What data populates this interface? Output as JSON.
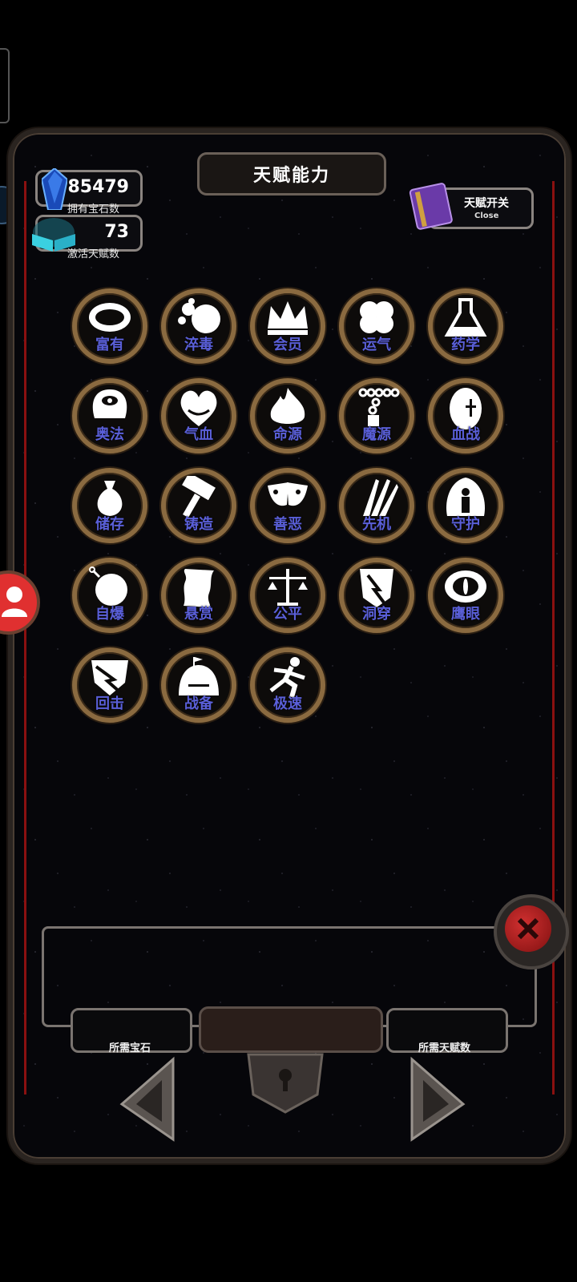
{
  "header": {
    "title": "天赋能力"
  },
  "stats": {
    "gems": {
      "value": "85479",
      "label": "拥有宝石数"
    },
    "talents": {
      "value": "73",
      "label": "激活天赋数"
    }
  },
  "toggle": {
    "label": "天赋开关",
    "sub": "Close"
  },
  "talents": [
    {
      "label": "富有",
      "icon": "ring-icon"
    },
    {
      "label": "淬毒",
      "icon": "poison-bubbles-icon"
    },
    {
      "label": "会员",
      "icon": "crown-icon"
    },
    {
      "label": "运气",
      "icon": "clover-icon"
    },
    {
      "label": "药学",
      "icon": "flask-icon"
    },
    {
      "label": "奥法",
      "icon": "eye-mask-icon"
    },
    {
      "label": "气血",
      "icon": "heart-icon"
    },
    {
      "label": "命源",
      "icon": "flame-icon"
    },
    {
      "label": "魔源",
      "icon": "chain-icon"
    },
    {
      "label": "血战",
      "icon": "blood-egg-icon"
    },
    {
      "label": "储存",
      "icon": "sack-icon"
    },
    {
      "label": "铸造",
      "icon": "hammer-icon"
    },
    {
      "label": "善恶",
      "icon": "masks-icon"
    },
    {
      "label": "先机",
      "icon": "claw-icon"
    },
    {
      "label": "守护",
      "icon": "guardian-icon"
    },
    {
      "label": "自爆",
      "icon": "bomb-icon"
    },
    {
      "label": "悬赏",
      "icon": "scroll-icon"
    },
    {
      "label": "公平",
      "icon": "scales-icon"
    },
    {
      "label": "洞穿",
      "icon": "pierce-shield-icon"
    },
    {
      "label": "鹰眼",
      "icon": "eagle-eye-icon"
    },
    {
      "label": "回击",
      "icon": "counter-shield-icon"
    },
    {
      "label": "战备",
      "icon": "camp-icon"
    },
    {
      "label": "极速",
      "icon": "runner-icon"
    }
  ],
  "footer": {
    "required_gems": "所需宝石",
    "required_talents": "所需天赋数"
  },
  "colors": {
    "label_blue": "#5a5fd8",
    "ring_bronze": "#8a6a40",
    "close_red": "#c02020"
  }
}
